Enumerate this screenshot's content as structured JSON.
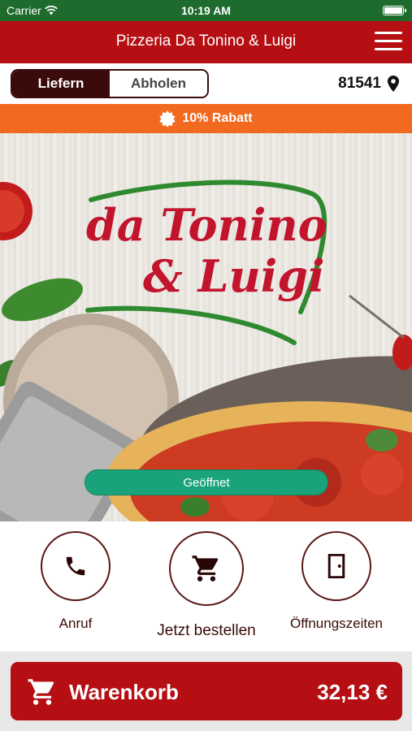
{
  "status_bar": {
    "carrier": "Carrier",
    "time": "10:19 AM"
  },
  "header": {
    "title": "Pizzeria Da Tonino & Luigi"
  },
  "order_mode": {
    "deliver": "Liefern",
    "pickup": "Abholen",
    "selected": "Liefern"
  },
  "location": {
    "postcode": "81541"
  },
  "discount": {
    "label": "10% Rabatt"
  },
  "hero": {
    "logo_line1": "da Tonino",
    "logo_line2": "& Luigi",
    "status": "Geöffnet"
  },
  "actions": [
    {
      "label": "Anruf",
      "icon": "phone-icon"
    },
    {
      "label": "Jetzt bestellen",
      "icon": "cart-icon"
    },
    {
      "label": "Öffnungszeiten",
      "icon": "door-icon"
    }
  ],
  "cart": {
    "label": "Warenkorb",
    "total": "32,13 €"
  },
  "colors": {
    "brand_red": "#b50f14",
    "dark_maroon": "#3b0a0a",
    "discount_orange": "#f26a1f",
    "open_green": "#1aa37a",
    "status_green": "#1e6b2e"
  }
}
